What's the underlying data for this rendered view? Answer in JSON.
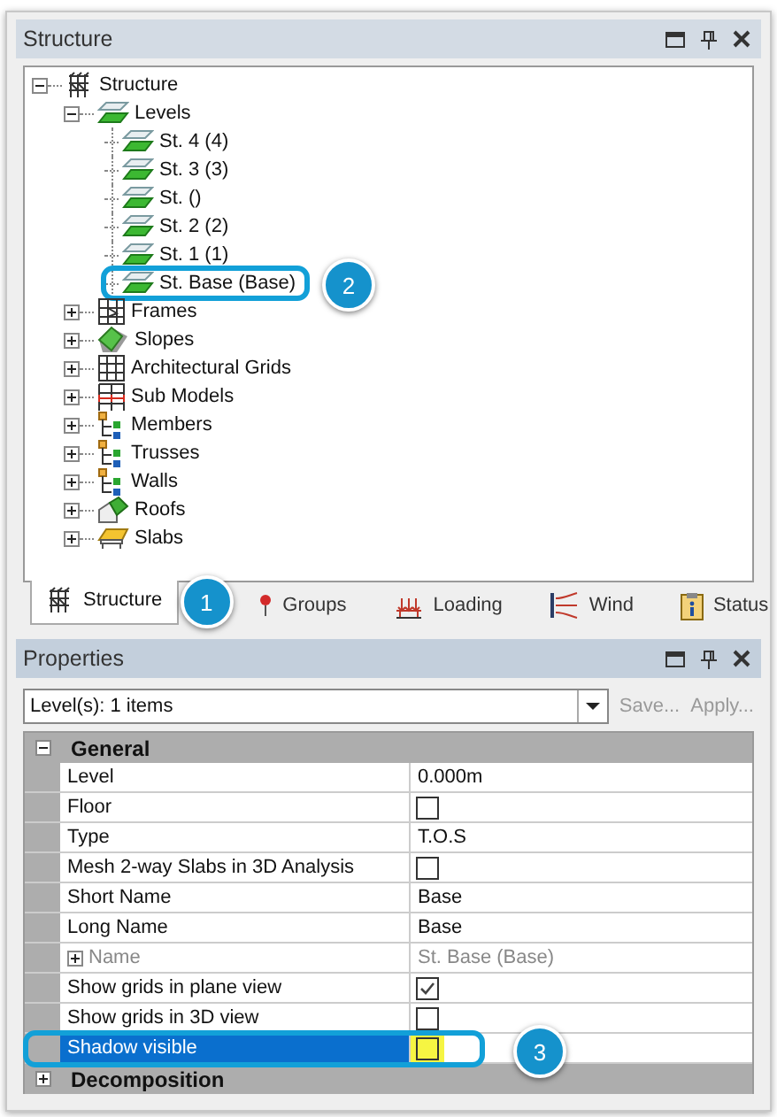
{
  "structure_panel": {
    "title": "Structure",
    "tree": [
      {
        "label": "Structure",
        "kind": "structure",
        "expanded": true,
        "children": [
          {
            "label": "Levels",
            "kind": "level",
            "expanded": true,
            "children": [
              {
                "label": "St. 4 (4)",
                "kind": "level"
              },
              {
                "label": "St. 3 (3)",
                "kind": "level"
              },
              {
                "label": "St.  ()",
                "kind": "level"
              },
              {
                "label": "St. 2 (2)",
                "kind": "level"
              },
              {
                "label": "St. 1 (1)",
                "kind": "level"
              },
              {
                "label": "St. Base (Base)",
                "kind": "level",
                "callout": "2"
              }
            ]
          },
          {
            "label": "Frames",
            "kind": "frame",
            "expanded": false
          },
          {
            "label": "Slopes",
            "kind": "slope",
            "expanded": false
          },
          {
            "label": "Architectural Grids",
            "kind": "grid",
            "expanded": false
          },
          {
            "label": "Sub Models",
            "kind": "submodel",
            "expanded": false
          },
          {
            "label": "Members",
            "kind": "members",
            "expanded": false
          },
          {
            "label": "Trusses",
            "kind": "members",
            "expanded": false
          },
          {
            "label": "Walls",
            "kind": "members",
            "expanded": false
          },
          {
            "label": "Roofs",
            "kind": "roof",
            "expanded": false
          },
          {
            "label": "Slabs",
            "kind": "slab",
            "expanded": false
          }
        ]
      }
    ],
    "tabs": [
      {
        "label": "Structure",
        "kind": "structure",
        "selected": true,
        "callout": "1"
      },
      {
        "label": "Groups",
        "kind": "groups",
        "selected": false
      },
      {
        "label": "Loading",
        "kind": "loading",
        "selected": false
      },
      {
        "label": "Wind",
        "kind": "wind",
        "selected": false
      },
      {
        "label": "Status",
        "kind": "status",
        "selected": false
      }
    ]
  },
  "properties_panel": {
    "title": "Properties",
    "selector": "Level(s): 1 items",
    "buttons": [
      {
        "label": "Save...",
        "disabled": true
      },
      {
        "label": "Apply...",
        "disabled": true
      }
    ],
    "categories": [
      {
        "name": "General",
        "expanded": true,
        "rows": [
          {
            "name": "Level",
            "kind": "text",
            "value": "0.000m"
          },
          {
            "name": "Floor",
            "kind": "checkbox",
            "checked": false
          },
          {
            "name": "Type",
            "kind": "text",
            "value": "T.O.S"
          },
          {
            "name": "Mesh 2-way Slabs in 3D Analysis",
            "kind": "checkbox",
            "checked": false
          },
          {
            "name": "Short Name",
            "kind": "text",
            "value": "Base"
          },
          {
            "name": "Long Name",
            "kind": "text",
            "value": "Base"
          },
          {
            "name": "Name",
            "kind": "text",
            "value": "St. Base (Base)",
            "disabled": true,
            "expandable": true
          },
          {
            "name": "Show grids in plane view",
            "kind": "checkbox",
            "checked": true
          },
          {
            "name": "Show grids in 3D view",
            "kind": "checkbox",
            "checked": false
          },
          {
            "name": "Shadow visible",
            "kind": "checkbox",
            "checked": false,
            "selected": true,
            "highlighted": true,
            "callout": "3"
          }
        ]
      },
      {
        "name": "Decomposition",
        "expanded": false
      }
    ]
  }
}
